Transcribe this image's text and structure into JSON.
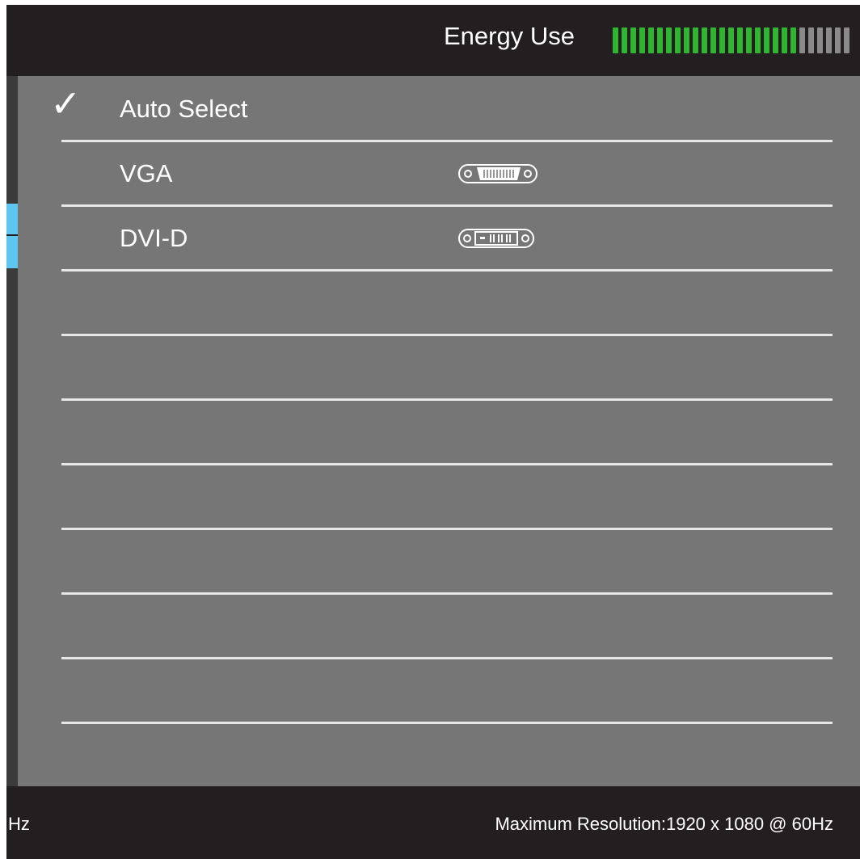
{
  "header": {
    "energy_label": "Energy Use",
    "energy_meter": {
      "active": 21,
      "total": 27,
      "active_color": "#2fb52f",
      "inactive_color": "#8a8a8a"
    }
  },
  "menu": {
    "items": [
      {
        "label": "Auto Select",
        "selected": true,
        "icon": ""
      },
      {
        "label": "VGA",
        "selected": false,
        "icon": "vga-port-icon"
      },
      {
        "label": "DVI-D",
        "selected": false,
        "icon": "dvi-port-icon"
      }
    ],
    "empty_rows": 8
  },
  "colors": {
    "header_bg": "#231f20",
    "panel_bg": "#767676",
    "divider": "#e6e6e6",
    "accent_tab": "#5fc6f2"
  },
  "footer": {
    "left_text": "Hz",
    "right_text": "Maximum Resolution:1920 x 1080 @ 60Hz"
  }
}
